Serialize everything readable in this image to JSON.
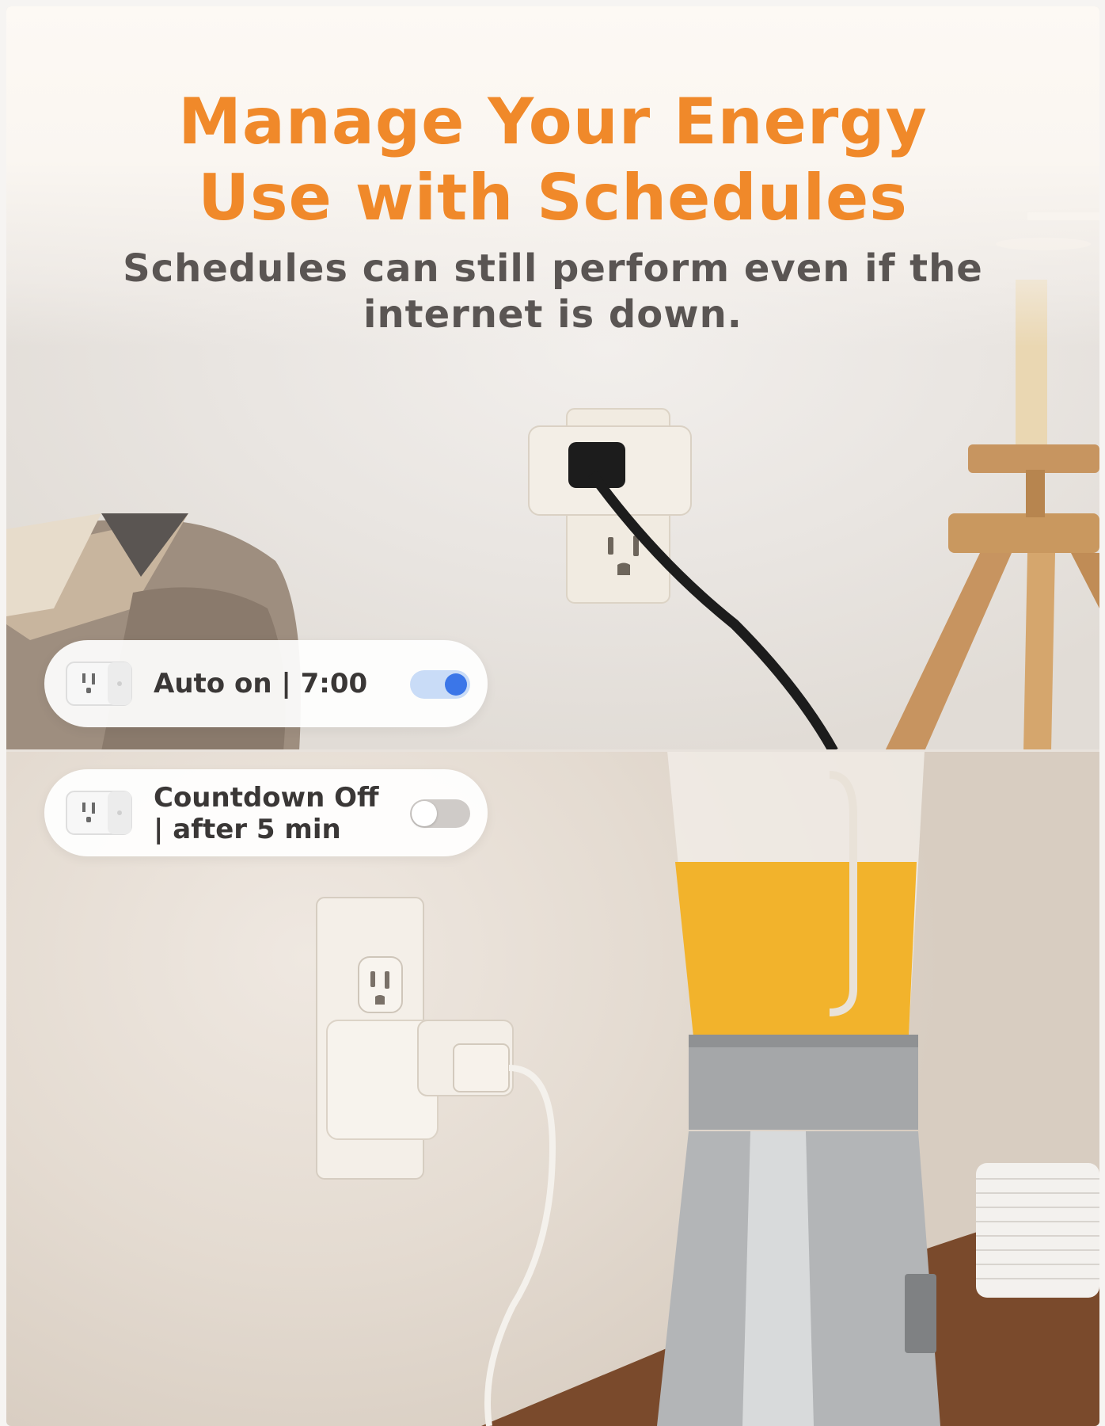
{
  "headline": {
    "line1": "Manage Your Energy",
    "line2": "Use with Schedules",
    "subtitle_line1": "Schedules can still perform even if the",
    "subtitle_line2": "internet is down."
  },
  "cards": [
    {
      "label": "Auto on | 7:00",
      "icon": "smart-plug-icon",
      "toggle_state": "on"
    },
    {
      "label_line1": "Countdown Off",
      "label_line2": "| after 5 min",
      "icon": "smart-plug-icon",
      "toggle_state": "off"
    }
  ],
  "colors": {
    "headline": "#f0892a",
    "subtitle": "#5a5553",
    "toggle_on": "#3b76e8",
    "toggle_off": "#cfcbc8"
  }
}
